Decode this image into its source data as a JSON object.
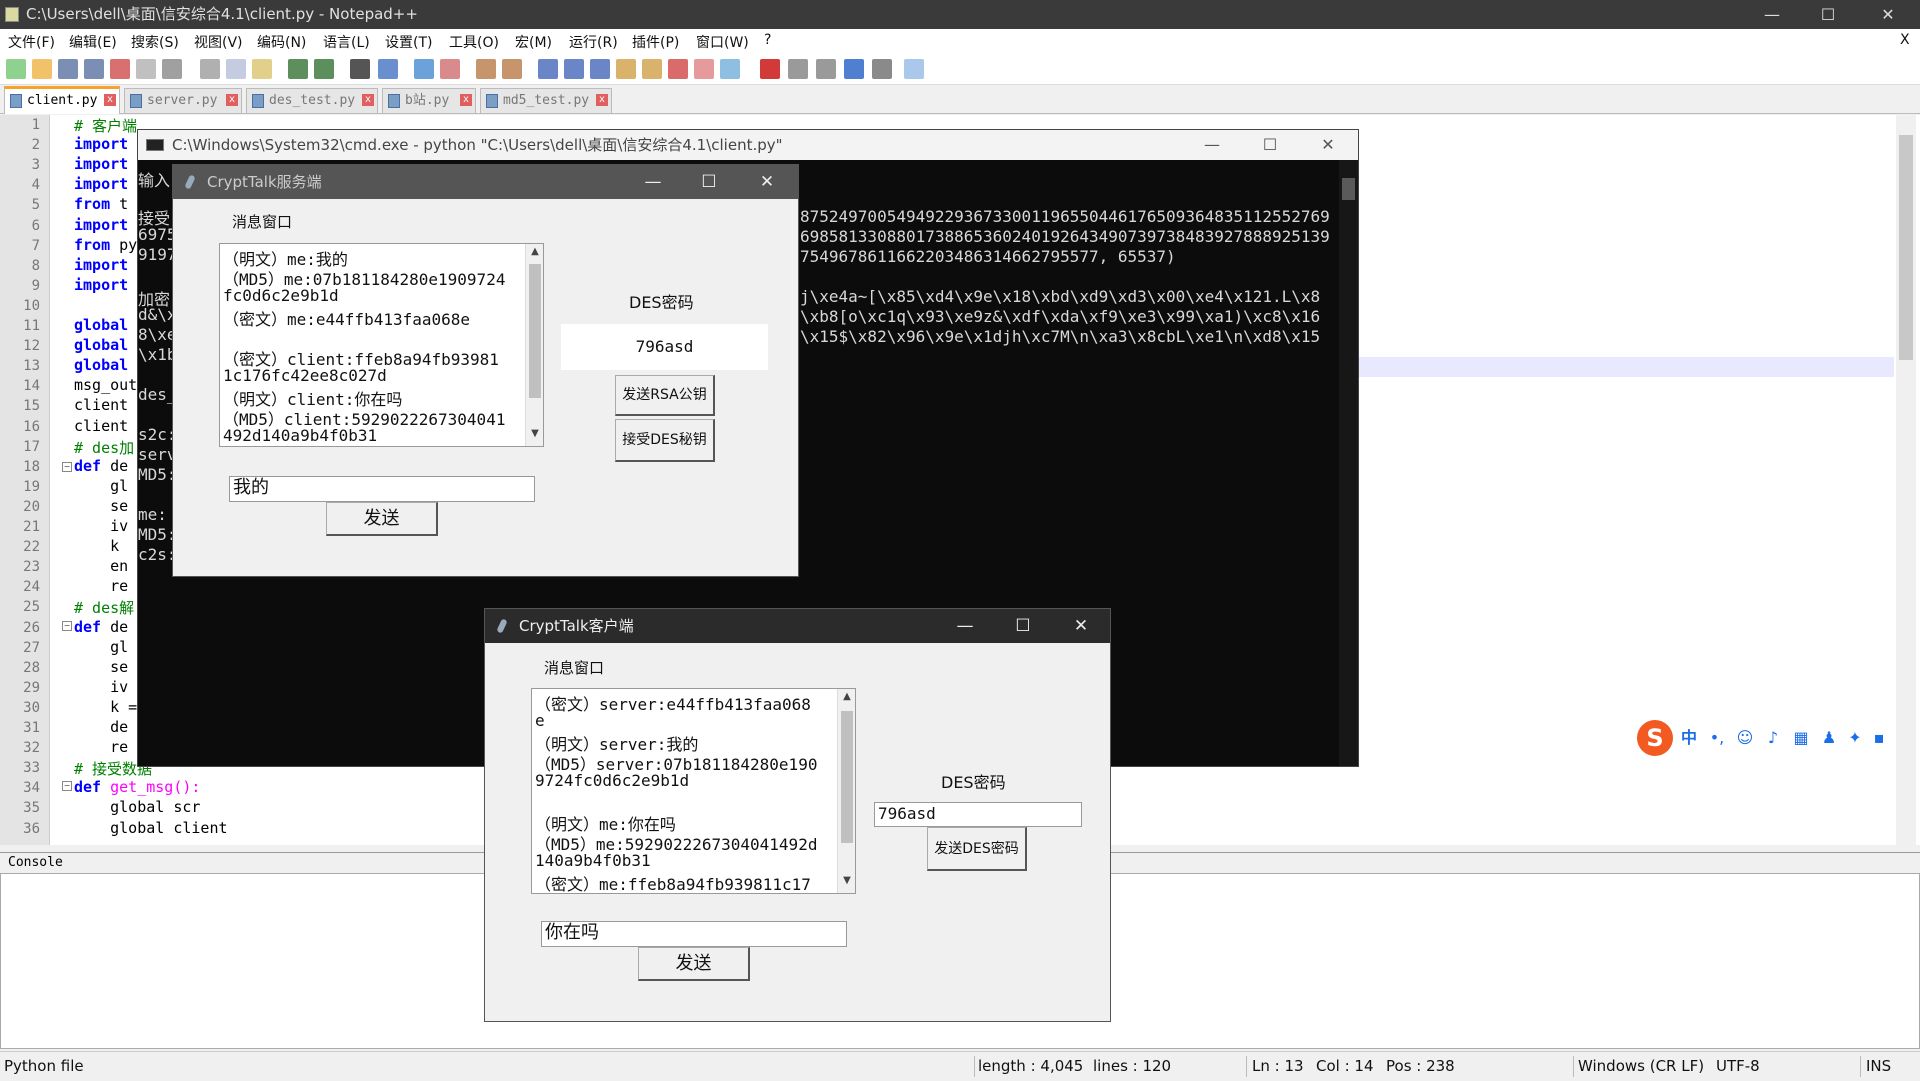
{
  "npp": {
    "title": "C:\\Users\\dell\\桌面\\信安综合4.1\\client.py - Notepad++",
    "menu": [
      "文件(F)",
      "编辑(E)",
      "搜索(S)",
      "视图(V)",
      "编码(N)",
      "语言(L)",
      "设置(T)",
      "工具(O)",
      "宏(M)",
      "运行(R)",
      "插件(P)",
      "窗口(W)",
      "?"
    ],
    "menu_close": "X",
    "tabs": [
      "client.py",
      "server.py",
      "des_test.py",
      "b站.py",
      "md5_test.py"
    ],
    "close_glyph": "x",
    "line_numbers": [
      "1",
      "2",
      "3",
      "4",
      "5",
      "6",
      "7",
      "8",
      "9",
      "10",
      "11",
      "12",
      "13",
      "14",
      "15",
      "16",
      "17",
      "18",
      "19",
      "20",
      "21",
      "22",
      "23",
      "24",
      "25",
      "26",
      "27",
      "28",
      "29",
      "30",
      "31",
      "32",
      "33",
      "34",
      "35",
      "36"
    ],
    "code": [
      {
        "kw": "",
        "cm": "# 客户端",
        "rest": ""
      },
      {
        "kw": "import",
        "cm": "",
        "rest": ""
      },
      {
        "kw": "import",
        "cm": "",
        "rest": ""
      },
      {
        "kw": "import",
        "cm": "",
        "rest": ""
      },
      {
        "kw": "from",
        "cm": "",
        "rest": " t"
      },
      {
        "kw": "import",
        "cm": "",
        "rest": ""
      },
      {
        "kw": "from",
        "cm": "",
        "rest": " py"
      },
      {
        "kw": "import",
        "cm": "",
        "rest": ""
      },
      {
        "kw": "import",
        "cm": "",
        "rest": ""
      },
      {
        "kw": "",
        "cm": "",
        "rest": ""
      },
      {
        "kw": "global",
        "cm": "",
        "rest": ""
      },
      {
        "kw": "global",
        "cm": "",
        "rest": ""
      },
      {
        "kw": "global",
        "cm": "",
        "rest": ""
      },
      {
        "kw": "",
        "cm": "",
        "rest": "msg_out"
      },
      {
        "kw": "",
        "cm": "",
        "rest": "client"
      },
      {
        "kw": "",
        "cm": "",
        "rest": "client"
      },
      {
        "kw": "",
        "cm": "# des加",
        "rest": ""
      },
      {
        "kw": "def",
        "cm": "",
        "rest": " de"
      },
      {
        "kw": "",
        "cm": "",
        "rest": "    gl"
      },
      {
        "kw": "",
        "cm": "",
        "rest": "    se"
      },
      {
        "kw": "",
        "cm": "",
        "rest": "    iv"
      },
      {
        "kw": "",
        "cm": "",
        "rest": "    k "
      },
      {
        "kw": "",
        "cm": "",
        "rest": "    en"
      },
      {
        "kw": "",
        "cm": "",
        "rest": "    re"
      },
      {
        "kw": "",
        "cm": "# des解",
        "rest": ""
      },
      {
        "kw": "def",
        "cm": "",
        "rest": " de"
      },
      {
        "kw": "",
        "cm": "",
        "rest": "    gl"
      },
      {
        "kw": "",
        "cm": "",
        "rest": "    se"
      },
      {
        "kw": "",
        "cm": "",
        "rest": "    iv"
      },
      {
        "kw": "",
        "cm": "",
        "rest": "    k ="
      },
      {
        "kw": "",
        "cm": "",
        "rest": "    de"
      },
      {
        "kw": "",
        "cm": "",
        "rest": "    re"
      },
      {
        "kw": "",
        "cm": "# 接受数据",
        "rest": ""
      },
      {
        "kw": "def",
        "cm": "",
        "rest": " get_msg():"
      },
      {
        "kw": "",
        "cm": "",
        "rest": "    global scr"
      },
      {
        "kw": "",
        "cm": "",
        "rest": "    global client"
      }
    ],
    "console_label": "Console",
    "status": {
      "filetype": "Python file",
      "length": "length : 4,045",
      "lines": "lines : 120",
      "ln": "Ln : 13",
      "col": "Col : 14",
      "pos": "Pos : 238",
      "eol": "Windows (CR LF)",
      "encoding": "UTF-8",
      "ins": "INS"
    }
  },
  "cmd": {
    "title": "C:\\Windows\\System32\\cmd.exe - python  \"C:\\Users\\dell\\桌面\\信安综合4.1\\client.py\"",
    "left_fragments": [
      "输入",
      "接受",
      "6975",
      "9197",
      "加密",
      "d&\\x",
      "8\\xe",
      "\\x1b",
      "des_",
      "s2c:",
      "serv",
      "MD5:",
      "me:",
      "MD5:",
      "c2s:"
    ],
    "right_lines": [
      "8752497005494922936733001196550446176509364835112552769",
      "6985813308801738865360240192643490739738483927888925139",
      "7549678611662203486314662795577, 65537)",
      "j\\xe4a~[\\x85\\xd4\\x9e\\x18\\xbd\\xd9\\xd3\\x00\\xe4\\x121.L\\x8",
      "\\xb8[o\\xc1q\\x93\\xe9z&\\xdf\\xda\\xf9\\xe3\\x99\\xa1)\\xc8\\x16",
      "\\x15$\\x82\\x96\\x9e\\x1djh\\xc7M\\n\\xa3\\x8cbL\\xe1\\n\\xd8\\x15"
    ]
  },
  "server_win": {
    "title": "CryptTalk服务端",
    "msg_label": "消息窗口",
    "messages": [
      "（明文）me:我的",
      "（MD5）me:07b181184280e1909724",
      "fc0d6c2e9b1d",
      "（密文）me:e44ffb413faa068e",
      "",
      "（密文）client:ffeb8a94fb93981",
      "1c176fc42ee8c027d",
      "（明文）client:你在吗",
      "（MD5）client:5929022267304041",
      "492d140a9b4f0b31"
    ],
    "input_value": "我的",
    "send_label": "发送",
    "des_label": "DES密码",
    "des_value": "796asd",
    "send_rsa_label": "发送RSA公钥",
    "recv_des_label": "接受DES秘钥"
  },
  "client_win": {
    "title": "CryptTalk客户端",
    "msg_label": "消息窗口",
    "messages": [
      "（密文）server:e44ffb413faa068",
      "e",
      "（明文）server:我的",
      "（MD5）server:07b181184280e190",
      "9724fc0d6c2e9b1d",
      "",
      "（明文）me:你在吗",
      "（MD5）me:5929022267304041492d",
      "140a9b4f0b31",
      "（密文）me:ffeb8a94fb939811c17"
    ],
    "input_value": "你在吗",
    "send_label": "发送",
    "des_label": "DES密码",
    "des_value": "796asd",
    "send_des_label": "发送DES密码"
  },
  "window_controls": {
    "minimize": "—",
    "maximize": "☐",
    "close": "✕"
  },
  "ime": {
    "logo": "S",
    "lang": "中",
    "punct": "•,"
  },
  "colors": {
    "keyword": "#0000ff",
    "comment": "#008000",
    "function": "#ff00ff",
    "tab_accent": "#f7a22a",
    "ime_accent": "#1a6ee8"
  }
}
